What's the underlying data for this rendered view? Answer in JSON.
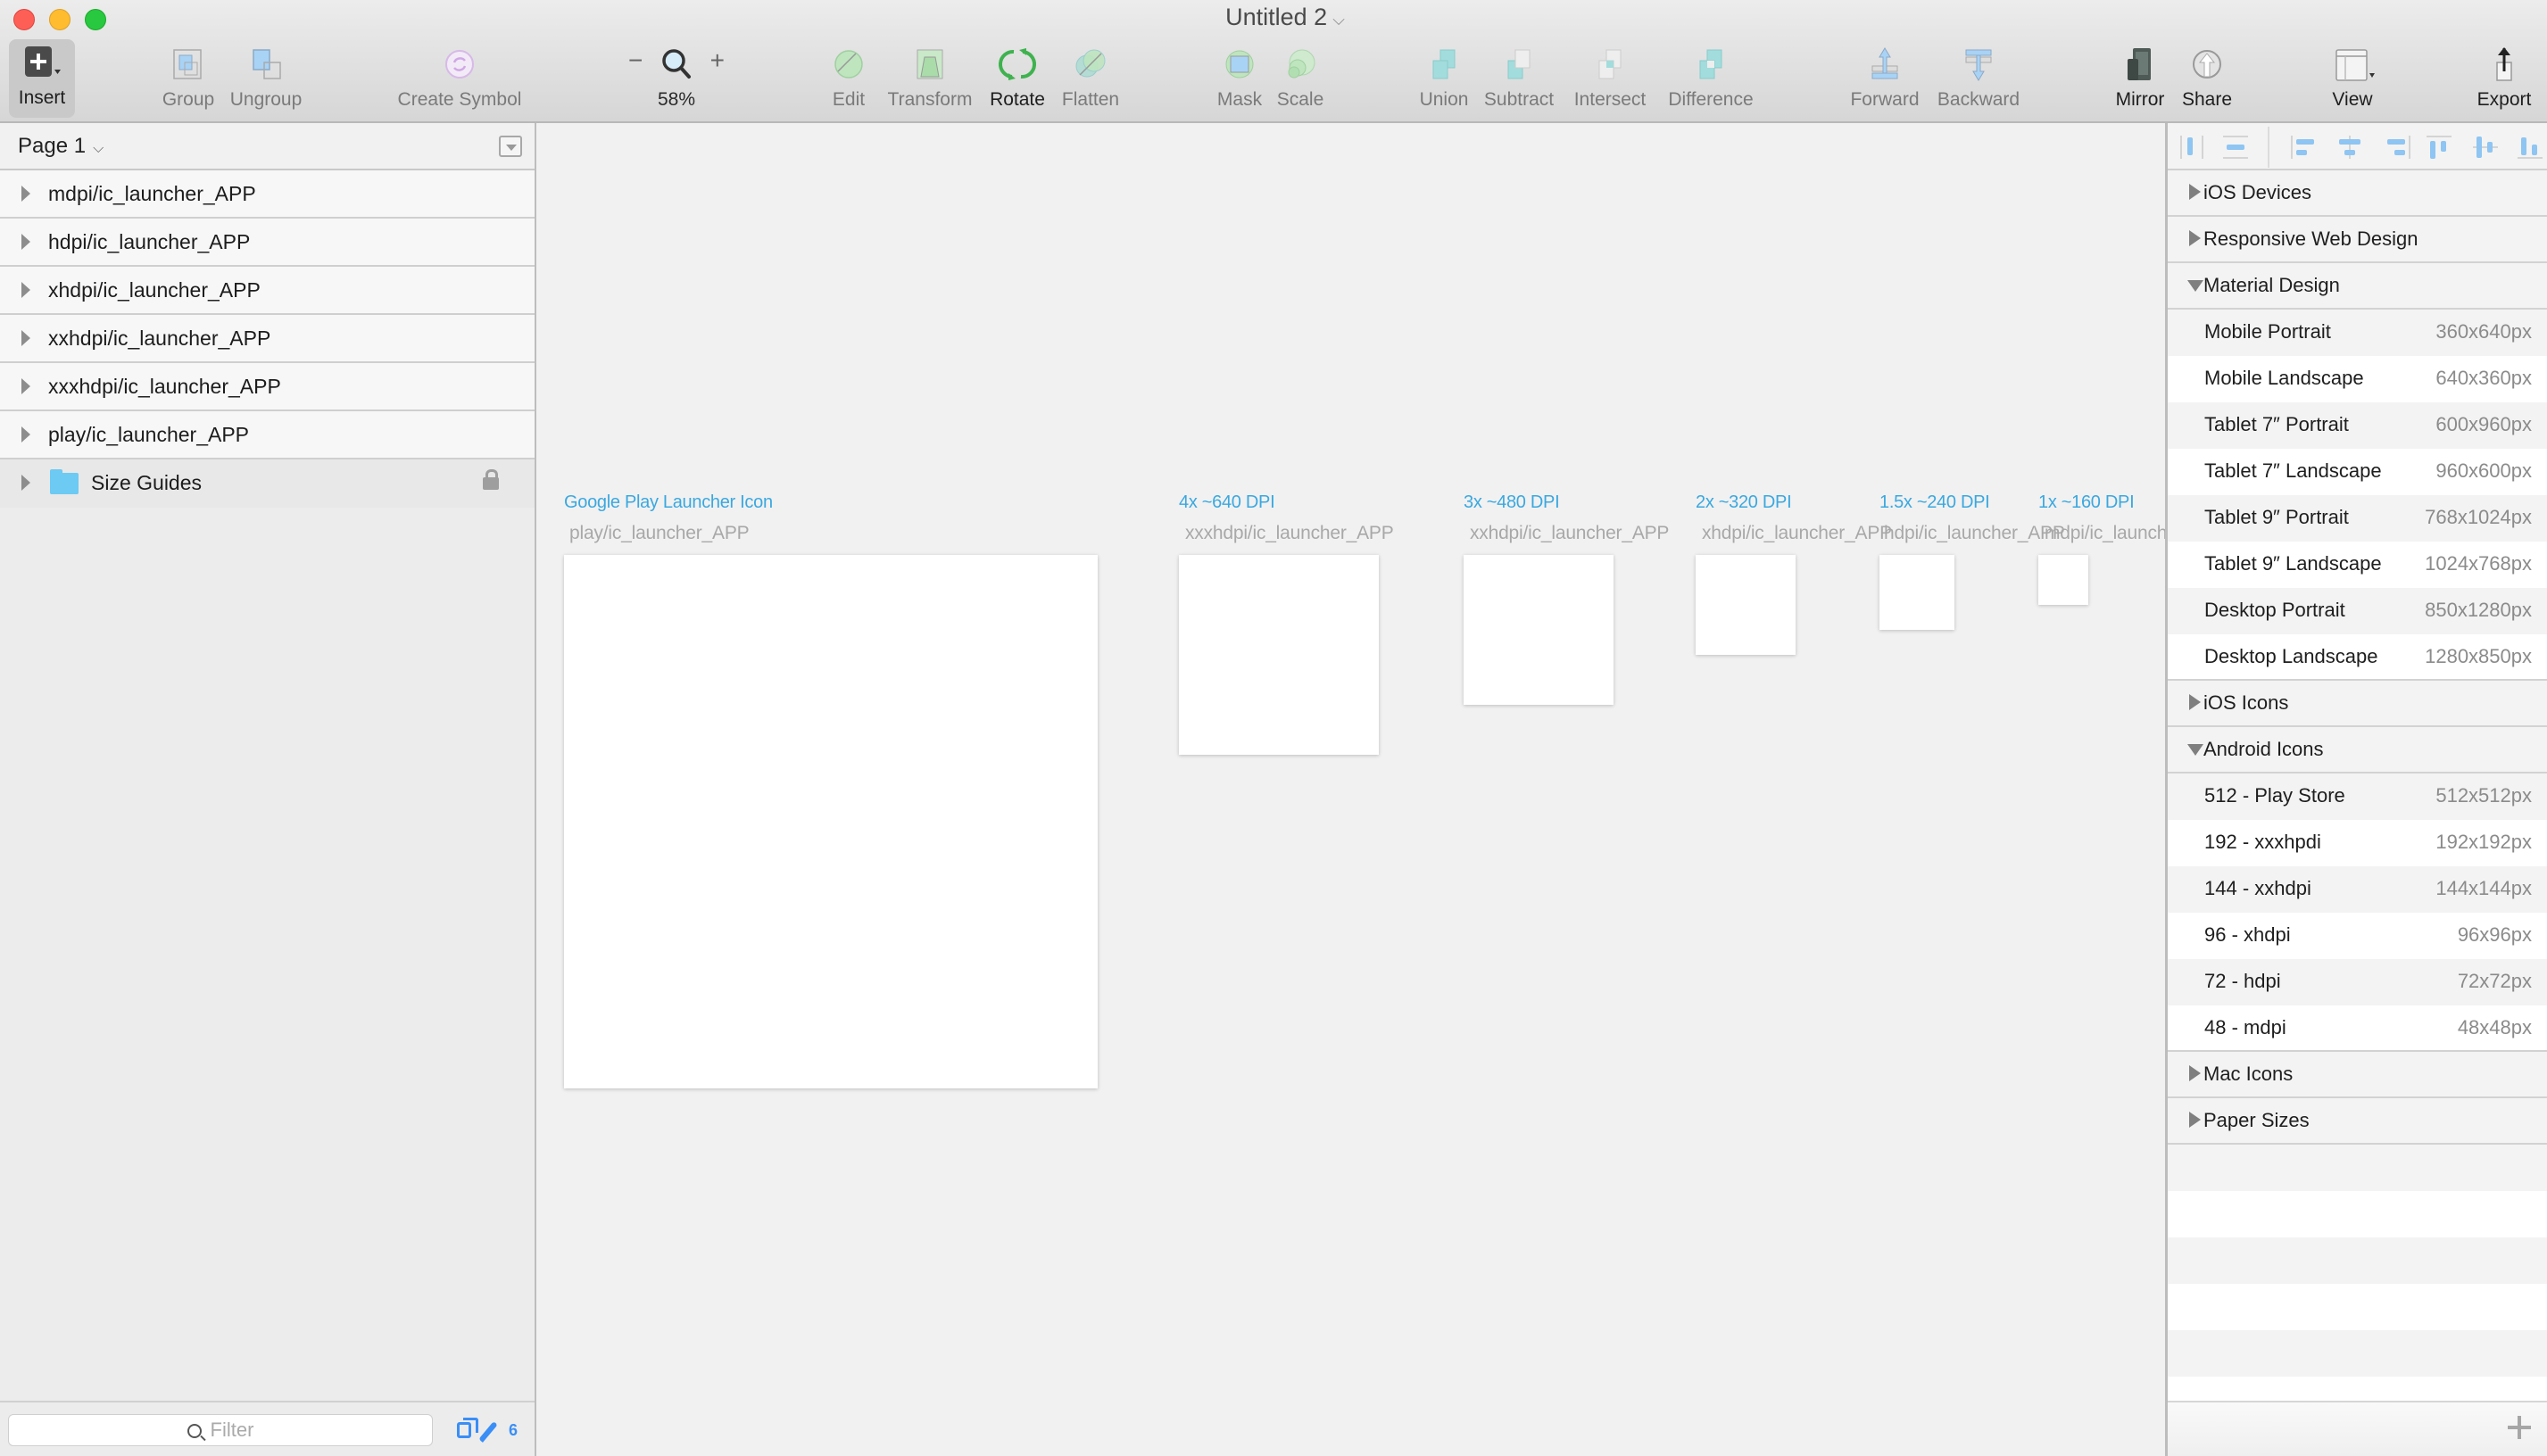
{
  "window": {
    "title": "Untitled 2",
    "title_chevron_icon": "chevron-down-icon"
  },
  "toolbar": {
    "items": [
      {
        "id": "insert",
        "label": "Insert",
        "icon": "plus-square-icon"
      },
      {
        "id": "group",
        "label": "Group",
        "icon": "group-icon"
      },
      {
        "id": "ungroup",
        "label": "Ungroup",
        "icon": "ungroup-icon"
      },
      {
        "id": "create-symbol",
        "label": "Create Symbol",
        "icon": "symbol-icon"
      },
      {
        "id": "zoom",
        "label": "58%",
        "icon": "magnifier-icon",
        "zoom_out": "−",
        "zoom_in": "+"
      },
      {
        "id": "edit",
        "label": "Edit",
        "icon": "edit-icon"
      },
      {
        "id": "transform",
        "label": "Transform",
        "icon": "transform-icon"
      },
      {
        "id": "rotate",
        "label": "Rotate",
        "icon": "rotate-icon"
      },
      {
        "id": "flatten",
        "label": "Flatten",
        "icon": "flatten-icon"
      },
      {
        "id": "mask",
        "label": "Mask",
        "icon": "mask-icon"
      },
      {
        "id": "scale",
        "label": "Scale",
        "icon": "scale-icon"
      },
      {
        "id": "union",
        "label": "Union",
        "icon": "union-icon"
      },
      {
        "id": "subtract",
        "label": "Subtract",
        "icon": "subtract-icon"
      },
      {
        "id": "intersect",
        "label": "Intersect",
        "icon": "intersect-icon"
      },
      {
        "id": "difference",
        "label": "Difference",
        "icon": "difference-icon"
      },
      {
        "id": "forward",
        "label": "Forward",
        "icon": "forward-icon"
      },
      {
        "id": "backward",
        "label": "Backward",
        "icon": "backward-icon"
      },
      {
        "id": "mirror",
        "label": "Mirror",
        "icon": "mirror-icon"
      },
      {
        "id": "share",
        "label": "Share",
        "icon": "share-icon"
      },
      {
        "id": "view",
        "label": "View",
        "icon": "view-icon"
      },
      {
        "id": "export",
        "label": "Export",
        "icon": "export-icon"
      }
    ]
  },
  "layers": {
    "page": "Page 1",
    "items": [
      {
        "name": "mdpi/ic_launcher_APP",
        "type": "artboard"
      },
      {
        "name": "hdpi/ic_launcher_APP",
        "type": "artboard"
      },
      {
        "name": "xhdpi/ic_launcher_APP",
        "type": "artboard"
      },
      {
        "name": "xxhdpi/ic_launcher_APP",
        "type": "artboard"
      },
      {
        "name": "xxxhdpi/ic_launcher_APP",
        "type": "artboard"
      },
      {
        "name": "play/ic_launcher_APP",
        "type": "artboard"
      },
      {
        "name": "Size Guides",
        "type": "group",
        "locked": true
      }
    ],
    "filter_placeholder": "Filter",
    "slice_count": "6"
  },
  "canvas": {
    "artboards": [
      {
        "title": "Google Play Launcher Icon",
        "name": "play/ic_launcher_APP"
      },
      {
        "title": "4x ~640 DPI",
        "name": "xxxhdpi/ic_launcher_APP"
      },
      {
        "title": "3x ~480 DPI",
        "name": "xxhdpi/ic_launcher_APP"
      },
      {
        "title": "2x ~320 DPI",
        "name": "xhdpi/ic_launcher_APP"
      },
      {
        "title": "1.5x ~240 DPI",
        "name": "hdpi/ic_launcher_APP"
      },
      {
        "title": "1x ~160 DPI",
        "name": "mdpi/ic_launcher_APP"
      }
    ]
  },
  "presets": {
    "align_tools": [
      "distribute-horizontal-icon",
      "distribute-vertical-icon",
      "align-left-icon",
      "align-center-icon",
      "align-right-icon",
      "align-top-icon",
      "align-middle-icon",
      "align-bottom-icon"
    ],
    "sections": [
      {
        "name": "iOS Devices",
        "expanded": false,
        "items": []
      },
      {
        "name": "Responsive Web Design",
        "expanded": false,
        "items": []
      },
      {
        "name": "Material Design",
        "expanded": true,
        "items": [
          {
            "name": "Mobile Portrait",
            "size": "360x640px"
          },
          {
            "name": "Mobile Landscape",
            "size": "640x360px"
          },
          {
            "name": "Tablet 7″ Portrait",
            "size": "600x960px"
          },
          {
            "name": "Tablet 7″ Landscape",
            "size": "960x600px"
          },
          {
            "name": "Tablet 9″ Portrait",
            "size": "768x1024px"
          },
          {
            "name": "Tablet 9″ Landscape",
            "size": "1024x768px"
          },
          {
            "name": "Desktop Portrait",
            "size": "850x1280px"
          },
          {
            "name": "Desktop Landscape",
            "size": "1280x850px"
          }
        ]
      },
      {
        "name": "iOS Icons",
        "expanded": false,
        "items": []
      },
      {
        "name": "Android Icons",
        "expanded": true,
        "items": [
          {
            "name": "512 - Play Store",
            "size": "512x512px"
          },
          {
            "name": "192 - xxxhpdi",
            "size": "192x192px"
          },
          {
            "name": "144 - xxhdpi",
            "size": "144x144px"
          },
          {
            "name": "96 - xhdpi",
            "size": "96x96px"
          },
          {
            "name": "72 - hdpi",
            "size": "72x72px"
          },
          {
            "name": "48 - mdpi",
            "size": "48x48px"
          }
        ]
      },
      {
        "name": "Mac Icons",
        "expanded": false,
        "items": []
      },
      {
        "name": "Paper Sizes",
        "expanded": false,
        "items": []
      }
    ],
    "add_label": "+"
  }
}
